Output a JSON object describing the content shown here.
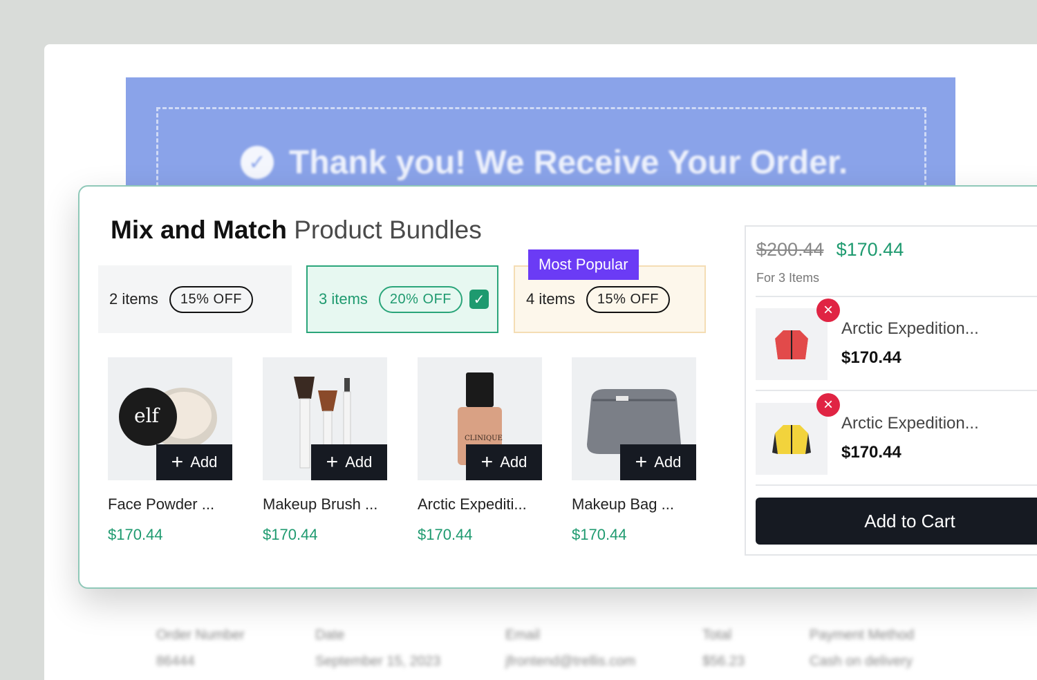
{
  "banner": {
    "text": "Thank you! We Receive Your Order.",
    "check_icon": "check-circle-icon"
  },
  "blurred_table": {
    "headers": [
      "Order Number",
      "Date",
      "Email",
      "Total",
      "Payment Method"
    ],
    "values": [
      "86444",
      "September 15, 2023",
      "jfrontend@trellis.com",
      "$56.23",
      "Cash on delivery"
    ]
  },
  "widget": {
    "title_bold": "Mix and Match",
    "title_light": "Product Bundles",
    "tiers": [
      {
        "items": "2 items",
        "discount": "15% OFF"
      },
      {
        "items": "3 items",
        "discount": "20% OFF",
        "selected": true
      },
      {
        "items": "4 items",
        "discount": "15% OFF",
        "badge": "Most Popular"
      }
    ],
    "products": [
      {
        "name": "Face Powder ...",
        "price": "$170.44",
        "add_label": "Add",
        "image": "face-powder"
      },
      {
        "name": "Makeup Brush ...",
        "price": "$170.44",
        "add_label": "Add",
        "image": "makeup-brush"
      },
      {
        "name": "Arctic Expediti...",
        "price": "$170.44",
        "add_label": "Add",
        "image": "foundation-bottle"
      },
      {
        "name": "Makeup Bag ...",
        "price": "$170.44",
        "add_label": "Add",
        "image": "makeup-bag"
      }
    ],
    "summary": {
      "old_price": "$200.44",
      "new_price": "$170.44",
      "for_items": "For 3 Items",
      "line_items": [
        {
          "name": "Arctic Expedition...",
          "price": "$170.44",
          "color": "red"
        },
        {
          "name": "Arctic Expedition...",
          "price": "$170.44",
          "color": "yellow"
        }
      ],
      "cart_label": "Add to Cart"
    }
  },
  "colors": {
    "accent": "#1e9a6f",
    "badge": "#6b3bf5",
    "remove": "#e02443",
    "dark": "#161a22",
    "banner": "#8aa3e9"
  }
}
